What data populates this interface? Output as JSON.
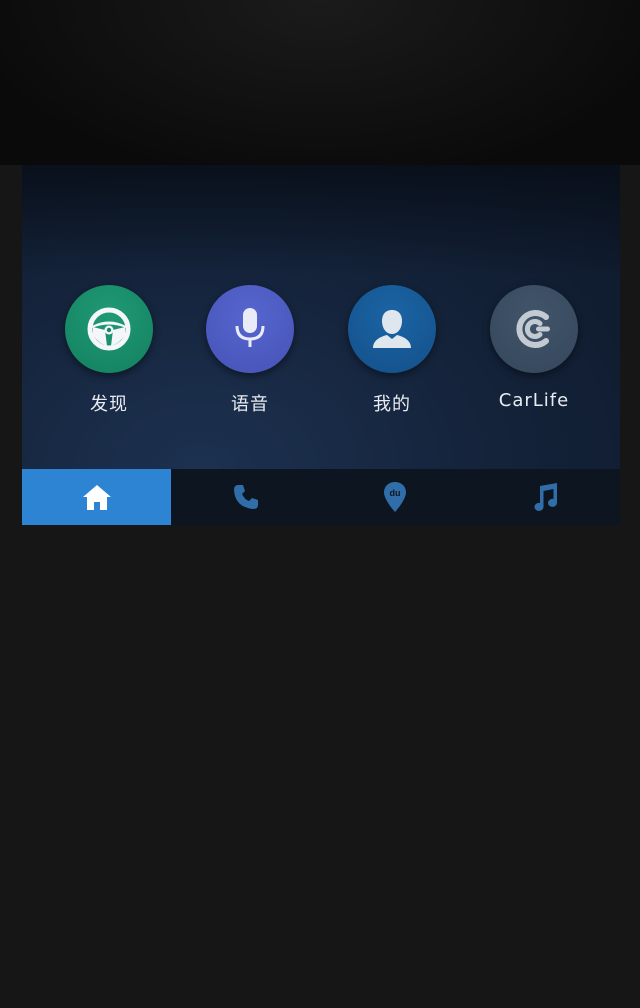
{
  "apps": [
    {
      "label": "发现",
      "icon": "steering-wheel-icon",
      "color": "#16886a"
    },
    {
      "label": "语音",
      "icon": "microphone-icon",
      "color": "#4c5ac2"
    },
    {
      "label": "我的",
      "icon": "user-icon",
      "color": "#165a97"
    },
    {
      "label": "CarLife",
      "icon": "carlife-logo-icon",
      "color": "#3b4d62"
    }
  ],
  "nav": {
    "active_tab": "home",
    "active_color": "#2d84d2",
    "inactive_icon_color": "#2f6ea8",
    "tabs": [
      {
        "id": "home",
        "icon": "home-icon"
      },
      {
        "id": "phone",
        "icon": "phone-icon"
      },
      {
        "id": "map",
        "icon": "map-pin-du-icon",
        "glyph_text": "du"
      },
      {
        "id": "music",
        "icon": "music-note-icon"
      }
    ]
  }
}
